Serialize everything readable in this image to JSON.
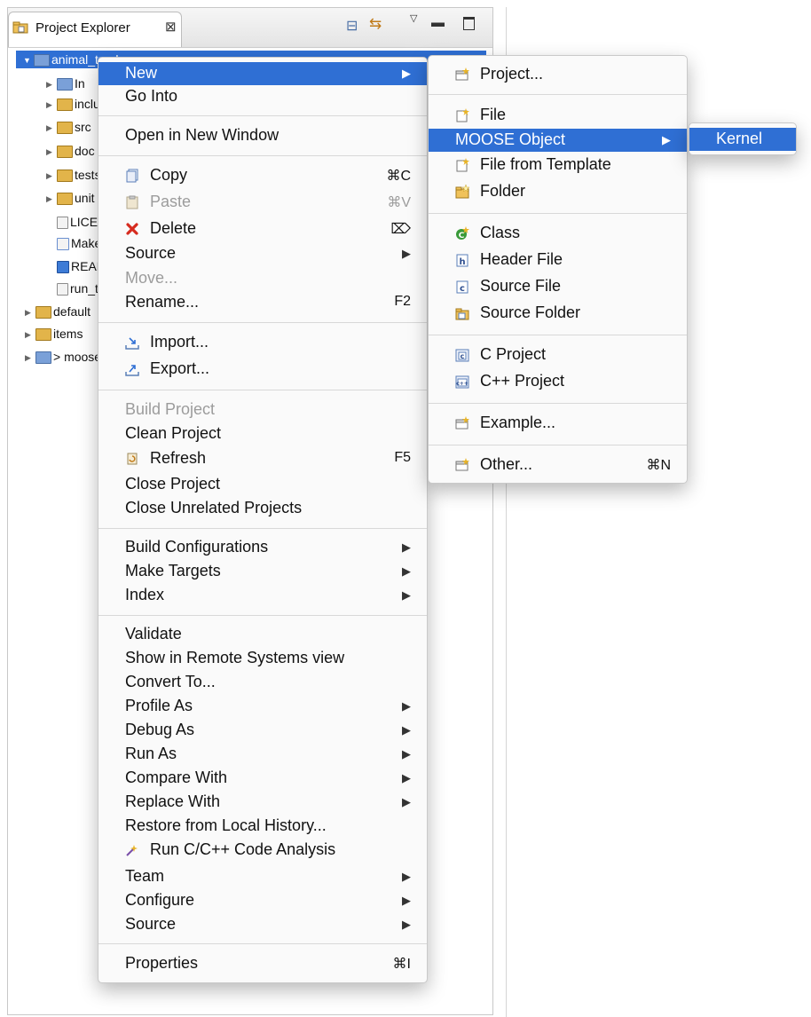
{
  "view": {
    "title": "Project Explorer",
    "close_glyph": "⊠",
    "toolbar": {
      "collapse_icon": "collapse-all-icon",
      "link_icon": "link-with-editor-icon",
      "menu_icon": "view-menu-icon",
      "minimize_icon": "minimize-icon",
      "maximize_icon": "maximize-icon"
    }
  },
  "tree": [
    {
      "label": "animal_tracker",
      "twisty": "▼",
      "icon": "project-icon"
    },
    {
      "label": "In",
      "twisty": "▶",
      "icon": "includes-icon"
    },
    {
      "label": "include",
      "twisty": "▶",
      "icon": "folder-icon"
    },
    {
      "label": "src",
      "twisty": "▶",
      "icon": "folder-icon"
    },
    {
      "label": "doc",
      "twisty": "▶",
      "icon": "folder-icon"
    },
    {
      "label": "tests",
      "twisty": "▶",
      "icon": "folder-icon"
    },
    {
      "label": "unit",
      "twisty": "▶",
      "icon": "folder-icon"
    },
    {
      "label": "LICENSE",
      "twisty": "",
      "icon": "file-icon"
    },
    {
      "label": "Makefile",
      "twisty": "",
      "icon": "makefile-icon"
    },
    {
      "label": "README",
      "twisty": "",
      "icon": "readme-icon"
    },
    {
      "label": "run_tests",
      "twisty": "",
      "icon": "file-icon"
    },
    {
      "label": "default",
      "twisty": "▶",
      "icon": "folder-icon"
    },
    {
      "label": "items",
      "twisty": "▶",
      "icon": "folder-icon"
    },
    {
      "label": "> moose",
      "twisty": "▶",
      "icon": "project-icon"
    }
  ],
  "context_menu": {
    "new": "New",
    "go_into": "Go Into",
    "open_new_window": "Open in New Window",
    "copy": "Copy",
    "copy_sc": "⌘C",
    "paste": "Paste",
    "paste_sc": "⌘V",
    "delete": "Delete",
    "delete_sc": "⌦",
    "source1": "Source",
    "move": "Move...",
    "rename": "Rename...",
    "rename_sc": "F2",
    "import": "Import...",
    "export": "Export...",
    "build_project": "Build Project",
    "clean_project": "Clean Project",
    "refresh": "Refresh",
    "refresh_sc": "F5",
    "close_project": "Close Project",
    "close_unrelated": "Close Unrelated Projects",
    "build_configs": "Build Configurations",
    "make_targets": "Make Targets",
    "index": "Index",
    "validate": "Validate",
    "show_remote": "Show in Remote Systems view",
    "convert_to": "Convert To...",
    "profile_as": "Profile As",
    "debug_as": "Debug As",
    "run_as": "Run As",
    "compare_with": "Compare With",
    "replace_with": "Replace With",
    "restore_history": "Restore from Local History...",
    "run_code_analysis": "Run C/C++ Code Analysis",
    "team": "Team",
    "configure": "Configure",
    "source2": "Source",
    "properties": "Properties",
    "properties_sc": "⌘I",
    "arrow": "▶"
  },
  "new_submenu": {
    "project": "Project...",
    "file": "File",
    "moose_object": "MOOSE Object",
    "file_from_template": "File from Template",
    "folder": "Folder",
    "class": "Class",
    "header_file": "Header File",
    "source_file": "Source File",
    "source_folder": "Source Folder",
    "c_project": "C Project",
    "cpp_project": "C++ Project",
    "example": "Example...",
    "other": "Other...",
    "other_sc": "⌘N"
  },
  "moose_submenu": {
    "kernel": "Kernel"
  },
  "colors": {
    "selection": "#2f6fd4",
    "menu_bg": "#fafafa"
  }
}
